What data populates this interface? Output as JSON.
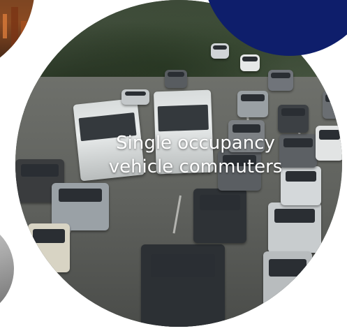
{
  "slide": {
    "caption": "Single occupancy vehicle commuters"
  },
  "colors": {
    "navy_accent": "#0e1e6b",
    "caption_text": "#ffffff",
    "background": "#ffffff"
  },
  "images": {
    "main": "traffic-jam-photo",
    "left_top": "city-street-photo",
    "left_bottom": "vehicle-photo"
  }
}
